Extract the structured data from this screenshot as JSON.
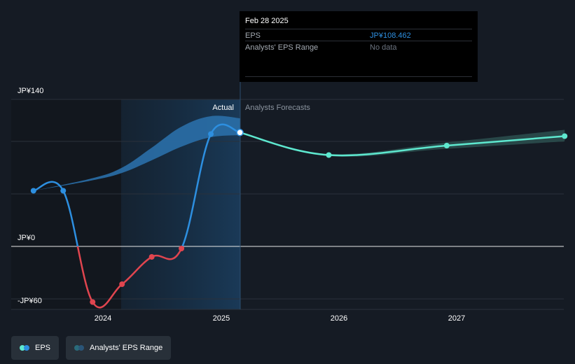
{
  "chart_data": {
    "type": "line",
    "y_unit_prefix": "JP¥",
    "ylim": [
      -60,
      140
    ],
    "ytick_labels": [
      "JP¥140",
      "JP¥0",
      "-JP¥60"
    ],
    "xtick_labels": [
      "2024",
      "2025",
      "2026",
      "2027"
    ],
    "region_labels": {
      "actual": "Actual",
      "forecast": "Analysts Forecasts"
    },
    "series": [
      {
        "name": "EPS",
        "kind": "actual",
        "points": [
          {
            "x": "2023-05-31",
            "y": 53
          },
          {
            "x": "2023-08-31",
            "y": 53
          },
          {
            "x": "2023-11-30",
            "y": -53
          },
          {
            "x": "2024-02-29",
            "y": -36
          },
          {
            "x": "2024-05-31",
            "y": -10
          },
          {
            "x": "2024-08-31",
            "y": -2
          },
          {
            "x": "2024-11-30",
            "y": 107
          },
          {
            "x": "2025-02-28",
            "y": 108.462
          }
        ]
      },
      {
        "name": "EPS",
        "kind": "forecast",
        "points": [
          {
            "x": "2025-02-28",
            "y": 108.462
          },
          {
            "x": "2025-11-30",
            "y": 87
          },
          {
            "x": "2026-11-30",
            "y": 96
          },
          {
            "x": "2027-11-30",
            "y": 105
          }
        ]
      }
    ],
    "actual_range_band": [
      {
        "x": "2023-05-31",
        "low": 53,
        "high": 53
      },
      {
        "x": "2023-11-30",
        "low": 63,
        "high": 65
      },
      {
        "x": "2024-02-29",
        "low": 70,
        "high": 75
      },
      {
        "x": "2024-05-31",
        "low": 82,
        "high": 94
      },
      {
        "x": "2024-08-31",
        "low": 95,
        "high": 114
      },
      {
        "x": "2024-11-30",
        "low": 104,
        "high": 124
      },
      {
        "x": "2025-02-28",
        "low": 106,
        "high": 122
      }
    ],
    "forecast_range_band": [
      {
        "x": "2025-02-28",
        "low": 108.462,
        "high": 108.462
      },
      {
        "x": "2025-11-30",
        "low": 86,
        "high": 88
      },
      {
        "x": "2026-11-30",
        "low": 93,
        "high": 99
      },
      {
        "x": "2027-11-30",
        "low": 100,
        "high": 111
      }
    ],
    "colors": {
      "eps_positive": "#2d8fe0",
      "eps_negative": "#e0454f",
      "forecast": "#5ee8cf",
      "band_actual": "#2a6fa8",
      "band_forecast": "#2a4c4c",
      "highlight": "#1a3650"
    }
  },
  "tooltip": {
    "date": "Feb 28 2025",
    "eps_label": "EPS",
    "eps_value": "JP¥108.462",
    "range_label": "Analysts' EPS Range",
    "range_value": "No data",
    "eps_value_color": "#2d8fe0",
    "range_value_color": "#6c7480"
  },
  "legend": {
    "eps_label": "EPS",
    "range_label": "Analysts' EPS Range"
  }
}
